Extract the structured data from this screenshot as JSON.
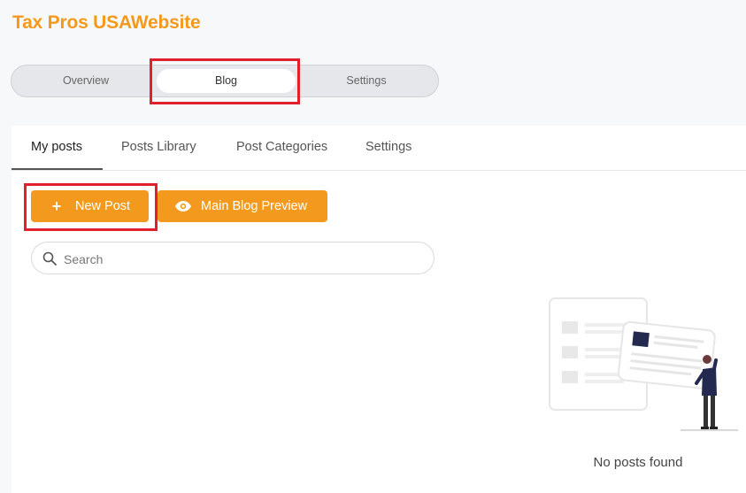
{
  "site": {
    "title": "Tax Pros USAWebsite"
  },
  "segment": {
    "items": [
      {
        "label": "Overview",
        "active": false
      },
      {
        "label": "Blog",
        "active": true
      },
      {
        "label": "Settings",
        "active": false
      }
    ]
  },
  "tabs": [
    {
      "label": "My posts",
      "active": true
    },
    {
      "label": "Posts Library",
      "active": false
    },
    {
      "label": "Post Categories",
      "active": false
    },
    {
      "label": "Settings",
      "active": false
    }
  ],
  "actions": {
    "new_post": {
      "label": "New Post",
      "icon": "plus-icon"
    },
    "preview": {
      "label": "Main Blog Preview",
      "icon": "eye-icon"
    }
  },
  "search": {
    "placeholder": "Search",
    "value": "",
    "icon": "search-icon"
  },
  "empty_state": {
    "text": "No posts found",
    "illustration": "empty-posts-illustration"
  },
  "colors": {
    "accent": "#f39a1e",
    "highlight": "#e0202b"
  }
}
